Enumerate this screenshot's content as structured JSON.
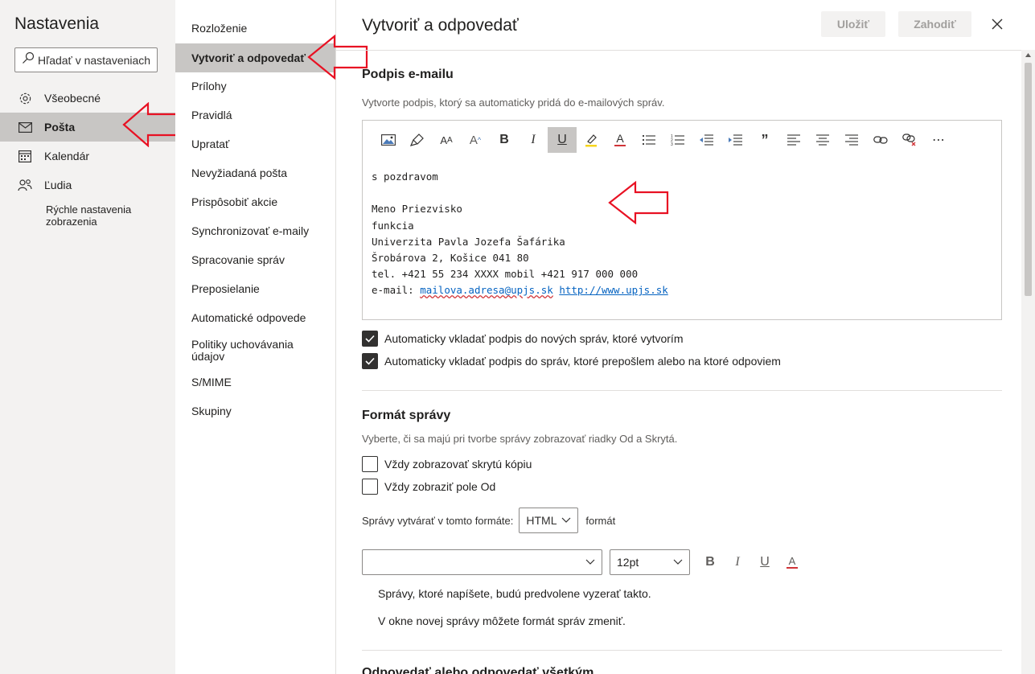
{
  "settings": {
    "title": "Nastavenia",
    "search_placeholder": "Hľadať v nastaveniach",
    "nav": [
      {
        "label": "Všeobecné",
        "icon": "gear-icon"
      },
      {
        "label": "Pošta",
        "icon": "mail-icon"
      },
      {
        "label": "Kalendár",
        "icon": "calendar-icon"
      },
      {
        "label": "Ľudia",
        "icon": "people-icon"
      }
    ],
    "quick": "Rýchle nastavenia zobrazenia"
  },
  "mail_menu": [
    "Rozloženie",
    "Vytvoriť a odpovedať",
    "Prílohy",
    "Pravidlá",
    "Upratať",
    "Nevyžiadaná pošta",
    "Prispôsobiť akcie",
    "Synchronizovať e-maily",
    "Spracovanie správ",
    "Preposielanie",
    "Automatické odpovede",
    "Politiky uchovávania údajov",
    "S/MIME",
    "Skupiny"
  ],
  "main": {
    "title": "Vytvoriť a odpovedať",
    "save": "Uložiť",
    "discard": "Zahodiť",
    "signature": {
      "title": "Podpis e-mailu",
      "desc": "Vytvorte podpis, ktorý sa automaticky pridá do e-mailových správ.",
      "lines": [
        "s pozdravom",
        "",
        "Meno Priezvisko",
        "funkcia",
        "Univerzita Pavla Jozefa Šafárika",
        "Šrobárova 2, Košice 041 80",
        "tel. +421 55 234 XXXX mobil +421 917 000 000"
      ],
      "email_prefix": "e-mail: ",
      "email": "mailova.adresa@upjs.sk",
      "web": "http://www.upjs.sk",
      "check_new": "Automaticky vkladať podpis do nových správ, ktoré vytvorím",
      "check_reply": "Automaticky vkladať podpis do správ, ktoré prepošlem alebo na ktoré odpoviem"
    },
    "format": {
      "title": "Formát správy",
      "desc": "Vyberte, či sa majú pri tvorbe správy zobrazovať riadky Od a Skrytá.",
      "bcc": "Vždy zobrazovať skrytú kópiu",
      "from": "Vždy zobraziť pole Od",
      "compose_label": "Správy vytvárať v tomto formáte:",
      "compose_value": "HTML",
      "compose_suffix": "formát",
      "font_value": "",
      "size_value": "12pt",
      "preview1": "Správy, ktoré napíšete, budú predvolene vyzerať takto.",
      "preview2": "V okne novej správy môžete formát správ zmeniť."
    },
    "next_section": "Odpovedať alebo odpovedať všetkým"
  }
}
